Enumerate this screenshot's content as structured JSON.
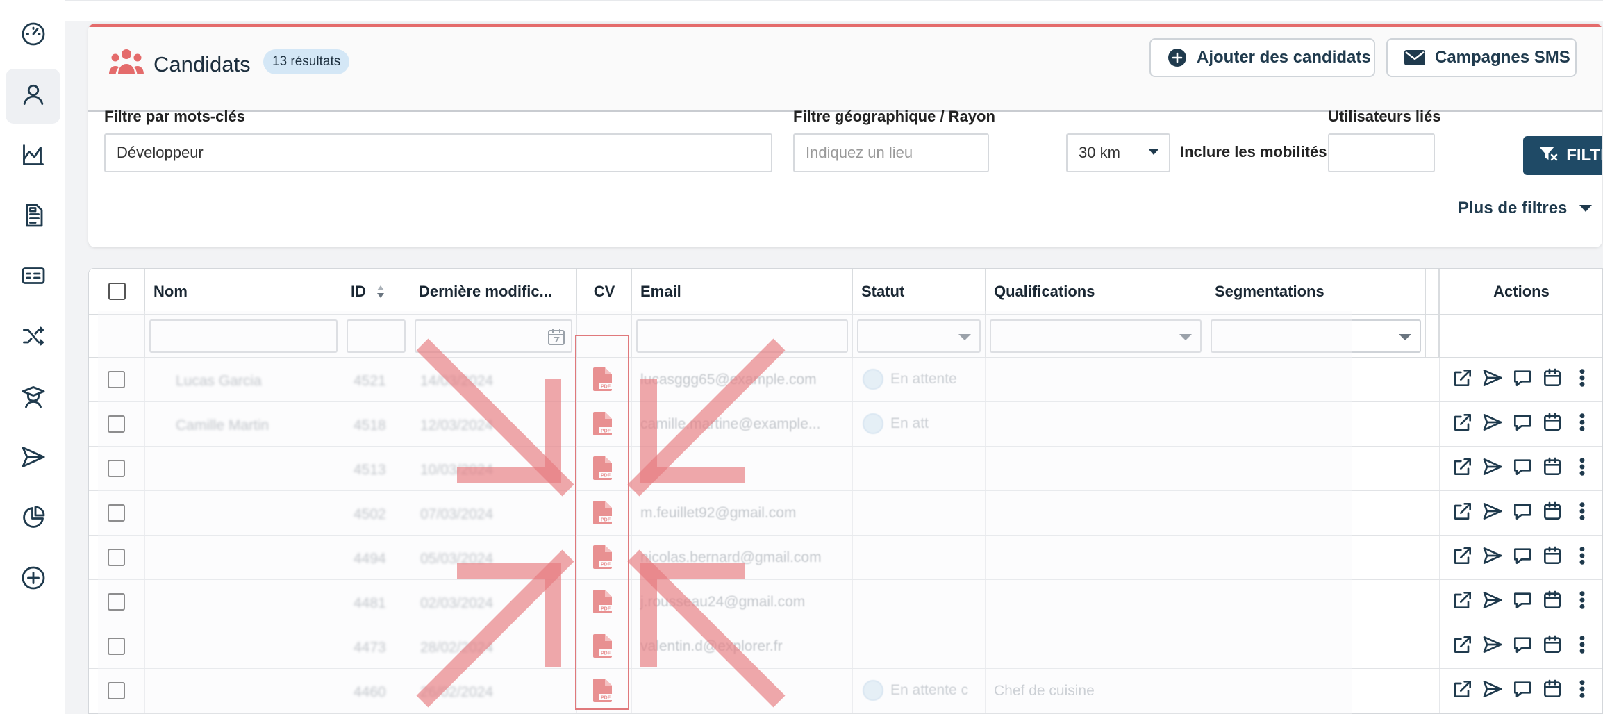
{
  "header": {
    "title": "Candidats",
    "badge": "13 résultats",
    "add_button": "Ajouter des candidats",
    "sms_button": "Campagnes SMS"
  },
  "filters": {
    "keywords_label": "Filtre par mots-clés",
    "keywords_value": "Développeur",
    "geo_label": "Filtre géographique / Rayon",
    "geo_placeholder": "Indiquez un lieu",
    "radius_value": "30 km",
    "mobility_label": "Inclure les mobilités",
    "mobility_on": false,
    "users_label": "Utilisateurs liés",
    "filter_button": "FILTRER",
    "more_filters": "Plus de filtres"
  },
  "table": {
    "columns": [
      "Nom",
      "ID",
      "Dernière modific...",
      "CV",
      "Email",
      "Statut",
      "Qualifications",
      "Segmentations",
      "Actions"
    ],
    "rows": [
      {
        "name": "Lucas Garcia",
        "id": "4521",
        "date": "14/03/2024",
        "email": "lucasggg65@example.com",
        "status": "En attente",
        "qualification": ""
      },
      {
        "name": "Camille Martin",
        "id": "4518",
        "date": "12/03/2024",
        "email": "camille.martine@example...",
        "status": "En att",
        "qualification": ""
      },
      {
        "name": "",
        "id": "4513",
        "date": "10/03/2024",
        "email": "",
        "status": "",
        "qualification": ""
      },
      {
        "name": "",
        "id": "4502",
        "date": "07/03/2024",
        "email": "m.feuillet92@gmail.com",
        "status": "",
        "qualification": ""
      },
      {
        "name": "",
        "id": "4494",
        "date": "05/03/2024",
        "email": "nicolas.bernard@gmail.com",
        "status": "",
        "qualification": ""
      },
      {
        "name": "",
        "id": "4481",
        "date": "02/03/2024",
        "email": "j.rousseau24@gmail.com",
        "status": "",
        "qualification": ""
      },
      {
        "name": "",
        "id": "4473",
        "date": "28/02/2024",
        "email": "valentin.d@explorer.fr",
        "status": "",
        "qualification": ""
      },
      {
        "name": "",
        "id": "4460",
        "date": "26/02/2024",
        "email": "",
        "status": "En attente c",
        "qualification": "Chef de cuisine"
      }
    ]
  },
  "icons": {
    "sidebar": [
      "dashboard-icon",
      "user-icon",
      "chart-icon",
      "document-icon",
      "id-card-icon",
      "shuffle-icon",
      "graduate-icon",
      "send-icon",
      "pie-chart-icon",
      "plus-circle-icon"
    ],
    "row_actions": [
      "open-external-icon",
      "send-icon",
      "comment-icon",
      "calendar-icon",
      "more-vertical-icon"
    ]
  },
  "colors": {
    "accent": "#1f4a66",
    "brand_red": "#e46b6b",
    "pdf_red": "#e05a5a",
    "badge_bg": "#d4e7f6"
  }
}
